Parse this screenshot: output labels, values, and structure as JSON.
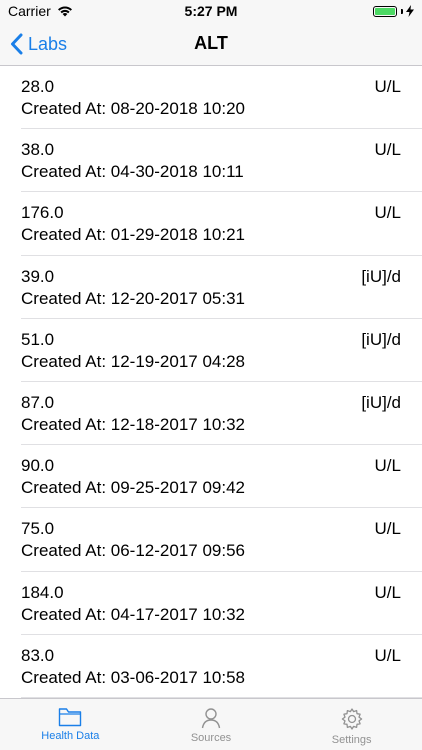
{
  "status_bar": {
    "carrier": "Carrier",
    "time": "5:27 PM"
  },
  "nav": {
    "back_label": "Labs",
    "title": "ALT"
  },
  "labs": [
    {
      "value": "28.0",
      "unit": "U/L",
      "created": "Created At: 08-20-2018 10:20"
    },
    {
      "value": "38.0",
      "unit": "U/L",
      "created": "Created At: 04-30-2018 10:11"
    },
    {
      "value": "176.0",
      "unit": "U/L",
      "created": "Created At: 01-29-2018 10:21"
    },
    {
      "value": "39.0",
      "unit": "[iU]/d",
      "created": "Created At: 12-20-2017 05:31"
    },
    {
      "value": "51.0",
      "unit": "[iU]/d",
      "created": "Created At: 12-19-2017 04:28"
    },
    {
      "value": "87.0",
      "unit": "[iU]/d",
      "created": "Created At: 12-18-2017 10:32"
    },
    {
      "value": "90.0",
      "unit": "U/L",
      "created": "Created At: 09-25-2017 09:42"
    },
    {
      "value": "75.0",
      "unit": "U/L",
      "created": "Created At: 06-12-2017 09:56"
    },
    {
      "value": "184.0",
      "unit": "U/L",
      "created": "Created At: 04-17-2017 10:32"
    },
    {
      "value": "83.0",
      "unit": "U/L",
      "created": "Created At: 03-06-2017 10:58"
    }
  ],
  "tabs": [
    {
      "label": "Health Data",
      "icon": "folder-icon",
      "active": true
    },
    {
      "label": "Sources",
      "icon": "person-icon",
      "active": false
    },
    {
      "label": "Settings",
      "icon": "gear-icon",
      "active": false
    }
  ],
  "colors": {
    "accent": "#1a7fe8",
    "inactive": "#929292",
    "battery": "#4cd964"
  }
}
